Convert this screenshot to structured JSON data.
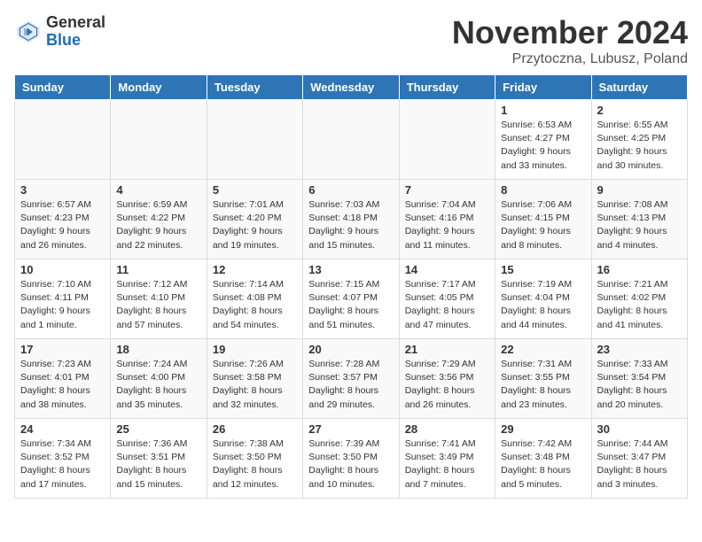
{
  "header": {
    "logo_line1": "General",
    "logo_line2": "Blue",
    "month_title": "November 2024",
    "location": "Przytoczna, Lubusz, Poland"
  },
  "days_of_week": [
    "Sunday",
    "Monday",
    "Tuesday",
    "Wednesday",
    "Thursday",
    "Friday",
    "Saturday"
  ],
  "weeks": [
    [
      {
        "day": "",
        "info": ""
      },
      {
        "day": "",
        "info": ""
      },
      {
        "day": "",
        "info": ""
      },
      {
        "day": "",
        "info": ""
      },
      {
        "day": "",
        "info": ""
      },
      {
        "day": "1",
        "info": "Sunrise: 6:53 AM\nSunset: 4:27 PM\nDaylight: 9 hours\nand 33 minutes."
      },
      {
        "day": "2",
        "info": "Sunrise: 6:55 AM\nSunset: 4:25 PM\nDaylight: 9 hours\nand 30 minutes."
      }
    ],
    [
      {
        "day": "3",
        "info": "Sunrise: 6:57 AM\nSunset: 4:23 PM\nDaylight: 9 hours\nand 26 minutes."
      },
      {
        "day": "4",
        "info": "Sunrise: 6:59 AM\nSunset: 4:22 PM\nDaylight: 9 hours\nand 22 minutes."
      },
      {
        "day": "5",
        "info": "Sunrise: 7:01 AM\nSunset: 4:20 PM\nDaylight: 9 hours\nand 19 minutes."
      },
      {
        "day": "6",
        "info": "Sunrise: 7:03 AM\nSunset: 4:18 PM\nDaylight: 9 hours\nand 15 minutes."
      },
      {
        "day": "7",
        "info": "Sunrise: 7:04 AM\nSunset: 4:16 PM\nDaylight: 9 hours\nand 11 minutes."
      },
      {
        "day": "8",
        "info": "Sunrise: 7:06 AM\nSunset: 4:15 PM\nDaylight: 9 hours\nand 8 minutes."
      },
      {
        "day": "9",
        "info": "Sunrise: 7:08 AM\nSunset: 4:13 PM\nDaylight: 9 hours\nand 4 minutes."
      }
    ],
    [
      {
        "day": "10",
        "info": "Sunrise: 7:10 AM\nSunset: 4:11 PM\nDaylight: 9 hours\nand 1 minute."
      },
      {
        "day": "11",
        "info": "Sunrise: 7:12 AM\nSunset: 4:10 PM\nDaylight: 8 hours\nand 57 minutes."
      },
      {
        "day": "12",
        "info": "Sunrise: 7:14 AM\nSunset: 4:08 PM\nDaylight: 8 hours\nand 54 minutes."
      },
      {
        "day": "13",
        "info": "Sunrise: 7:15 AM\nSunset: 4:07 PM\nDaylight: 8 hours\nand 51 minutes."
      },
      {
        "day": "14",
        "info": "Sunrise: 7:17 AM\nSunset: 4:05 PM\nDaylight: 8 hours\nand 47 minutes."
      },
      {
        "day": "15",
        "info": "Sunrise: 7:19 AM\nSunset: 4:04 PM\nDaylight: 8 hours\nand 44 minutes."
      },
      {
        "day": "16",
        "info": "Sunrise: 7:21 AM\nSunset: 4:02 PM\nDaylight: 8 hours\nand 41 minutes."
      }
    ],
    [
      {
        "day": "17",
        "info": "Sunrise: 7:23 AM\nSunset: 4:01 PM\nDaylight: 8 hours\nand 38 minutes."
      },
      {
        "day": "18",
        "info": "Sunrise: 7:24 AM\nSunset: 4:00 PM\nDaylight: 8 hours\nand 35 minutes."
      },
      {
        "day": "19",
        "info": "Sunrise: 7:26 AM\nSunset: 3:58 PM\nDaylight: 8 hours\nand 32 minutes."
      },
      {
        "day": "20",
        "info": "Sunrise: 7:28 AM\nSunset: 3:57 PM\nDaylight: 8 hours\nand 29 minutes."
      },
      {
        "day": "21",
        "info": "Sunrise: 7:29 AM\nSunset: 3:56 PM\nDaylight: 8 hours\nand 26 minutes."
      },
      {
        "day": "22",
        "info": "Sunrise: 7:31 AM\nSunset: 3:55 PM\nDaylight: 8 hours\nand 23 minutes."
      },
      {
        "day": "23",
        "info": "Sunrise: 7:33 AM\nSunset: 3:54 PM\nDaylight: 8 hours\nand 20 minutes."
      }
    ],
    [
      {
        "day": "24",
        "info": "Sunrise: 7:34 AM\nSunset: 3:52 PM\nDaylight: 8 hours\nand 17 minutes."
      },
      {
        "day": "25",
        "info": "Sunrise: 7:36 AM\nSunset: 3:51 PM\nDaylight: 8 hours\nand 15 minutes."
      },
      {
        "day": "26",
        "info": "Sunrise: 7:38 AM\nSunset: 3:50 PM\nDaylight: 8 hours\nand 12 minutes."
      },
      {
        "day": "27",
        "info": "Sunrise: 7:39 AM\nSunset: 3:50 PM\nDaylight: 8 hours\nand 10 minutes."
      },
      {
        "day": "28",
        "info": "Sunrise: 7:41 AM\nSunset: 3:49 PM\nDaylight: 8 hours\nand 7 minutes."
      },
      {
        "day": "29",
        "info": "Sunrise: 7:42 AM\nSunset: 3:48 PM\nDaylight: 8 hours\nand 5 minutes."
      },
      {
        "day": "30",
        "info": "Sunrise: 7:44 AM\nSunset: 3:47 PM\nDaylight: 8 hours\nand 3 minutes."
      }
    ]
  ]
}
